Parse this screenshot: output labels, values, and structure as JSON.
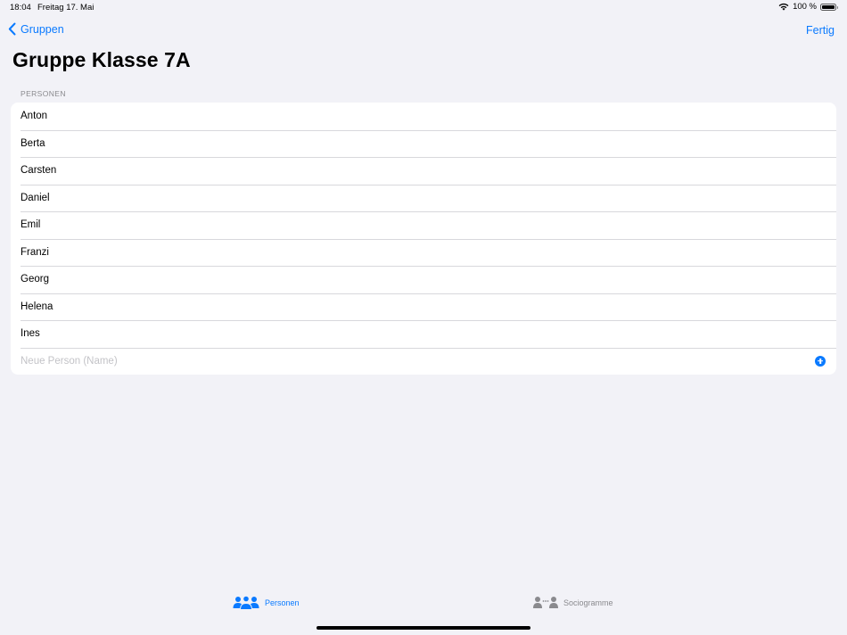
{
  "status_bar": {
    "time": "18:04",
    "date": "Freitag 17. Mai",
    "battery_percent": "100 %",
    "battery_level": 1.0,
    "icons": [
      "wifi-icon",
      "battery-icon"
    ]
  },
  "nav": {
    "back_label": "Gruppen",
    "done_label": "Fertig"
  },
  "title": "Gruppe Klasse 7A",
  "section": {
    "header": "PERSONEN",
    "persons": [
      "Anton",
      "Berta",
      "Carsten",
      "Daniel",
      "Emil",
      "Franzi",
      "Georg",
      "Helena",
      "Ines"
    ],
    "new_person": {
      "placeholder": "Neue Person (Name)",
      "value": "",
      "icon": "plus-circle-icon"
    }
  },
  "tabs": [
    {
      "label": "Personen",
      "icon": "people-icon",
      "selected": true
    },
    {
      "label": "Sociogramme",
      "icon": "sociogram-icon",
      "selected": false
    }
  ],
  "colors": {
    "accent": "#0a7aff",
    "background": "#f2f2f7",
    "inactive": "#8a8a8e"
  }
}
